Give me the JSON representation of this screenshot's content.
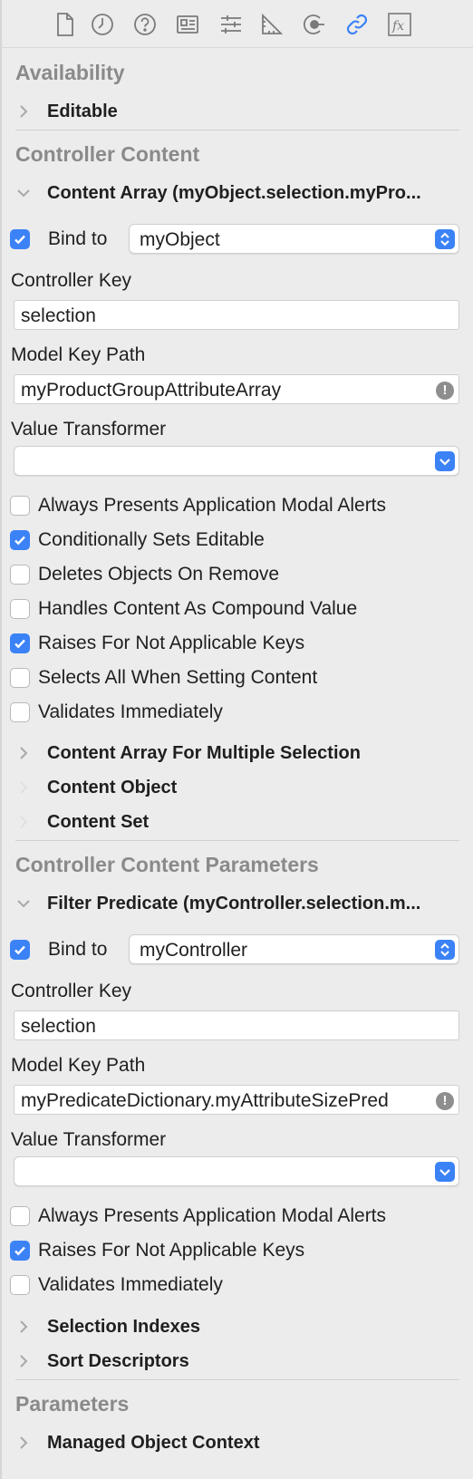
{
  "toolbar": {
    "icons": [
      "file-icon",
      "history-icon",
      "help-icon",
      "identity-icon",
      "attributes-icon",
      "size-icon",
      "connections-icon",
      "bindings-icon",
      "effects-icon"
    ],
    "active_color": "#3b82f6"
  },
  "sections": {
    "availability": {
      "title": "Availability",
      "editable": "Editable"
    },
    "controller_content": {
      "title": "Controller Content",
      "content_array": "Content Array (myObject.selection.myPro...",
      "bind_label": "Bind to",
      "bind_value": "myObject",
      "controller_key_label": "Controller Key",
      "controller_key_value": "selection",
      "model_key_path_label": "Model Key Path",
      "model_key_path_value": "myProductGroupAttributeArray",
      "value_transformer_label": "Value Transformer",
      "value_transformer_value": "",
      "options": [
        {
          "label": "Always Presents Application Modal Alerts",
          "checked": false
        },
        {
          "label": "Conditionally Sets Editable",
          "checked": true
        },
        {
          "label": "Deletes Objects On Remove",
          "checked": false
        },
        {
          "label": "Handles Content As Compound Value",
          "checked": false
        },
        {
          "label": "Raises For Not Applicable Keys",
          "checked": true
        },
        {
          "label": "Selects All When Setting Content",
          "checked": false
        },
        {
          "label": "Validates Immediately",
          "checked": false
        }
      ],
      "content_array_multiple": "Content Array For Multiple Selection",
      "content_object": "Content Object",
      "content_set": "Content Set"
    },
    "controller_content_parameters": {
      "title": "Controller Content Parameters",
      "filter_predicate": "Filter Predicate (myController.selection.m...",
      "bind_label": "Bind to",
      "bind_value": "myController",
      "controller_key_label": "Controller Key",
      "controller_key_value": "selection",
      "model_key_path_label": "Model Key Path",
      "model_key_path_value": "myPredicateDictionary.myAttributeSizePred",
      "value_transformer_label": "Value Transformer",
      "value_transformer_value": "",
      "options": [
        {
          "label": "Always Presents Application Modal Alerts",
          "checked": false
        },
        {
          "label": "Raises For Not Applicable Keys",
          "checked": true
        },
        {
          "label": "Validates Immediately",
          "checked": false
        }
      ],
      "selection_indexes": "Selection Indexes",
      "sort_descriptors": "Sort Descriptors"
    },
    "parameters": {
      "title": "Parameters",
      "managed_object_context": "Managed Object Context"
    }
  },
  "warning_glyph": "!",
  "accent_color": "#3b82f6"
}
